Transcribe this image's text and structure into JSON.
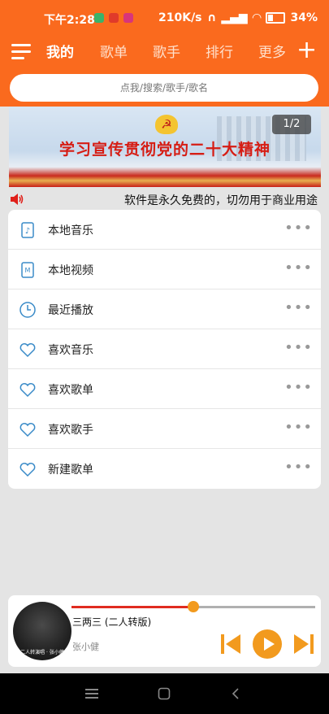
{
  "status": {
    "time": "下午2:28",
    "speed": "210K/s",
    "battery": "34%"
  },
  "nav": {
    "tabs": [
      "我的",
      "歌单",
      "歌手",
      "排行",
      "更多"
    ],
    "active": 0
  },
  "search": {
    "placeholder": "点我/搜索/歌手/歌名"
  },
  "banner": {
    "text": "学习宣传贯彻党的二十大精神",
    "page": "1/2"
  },
  "notice": {
    "text": "软件是永久免费的，切勿用于商业用途"
  },
  "list": [
    {
      "label": "本地音乐",
      "icon": "music-file-icon"
    },
    {
      "label": "本地视频",
      "icon": "video-file-icon"
    },
    {
      "label": "最近播放",
      "icon": "clock-icon"
    },
    {
      "label": "喜欢音乐",
      "icon": "heart-icon"
    },
    {
      "label": "喜欢歌单",
      "icon": "heart-icon"
    },
    {
      "label": "喜欢歌手",
      "icon": "heart-icon"
    },
    {
      "label": "新建歌单",
      "icon": "heart-icon"
    }
  ],
  "player": {
    "title": "三两三 (二人转版)",
    "artist": "张小健",
    "progress": 0.5,
    "cover_caption": "二人转演唱 · 张小健"
  },
  "colors": {
    "primary": "#fa6a1e",
    "accent": "#f29a1e",
    "progress": "#e02c20"
  }
}
